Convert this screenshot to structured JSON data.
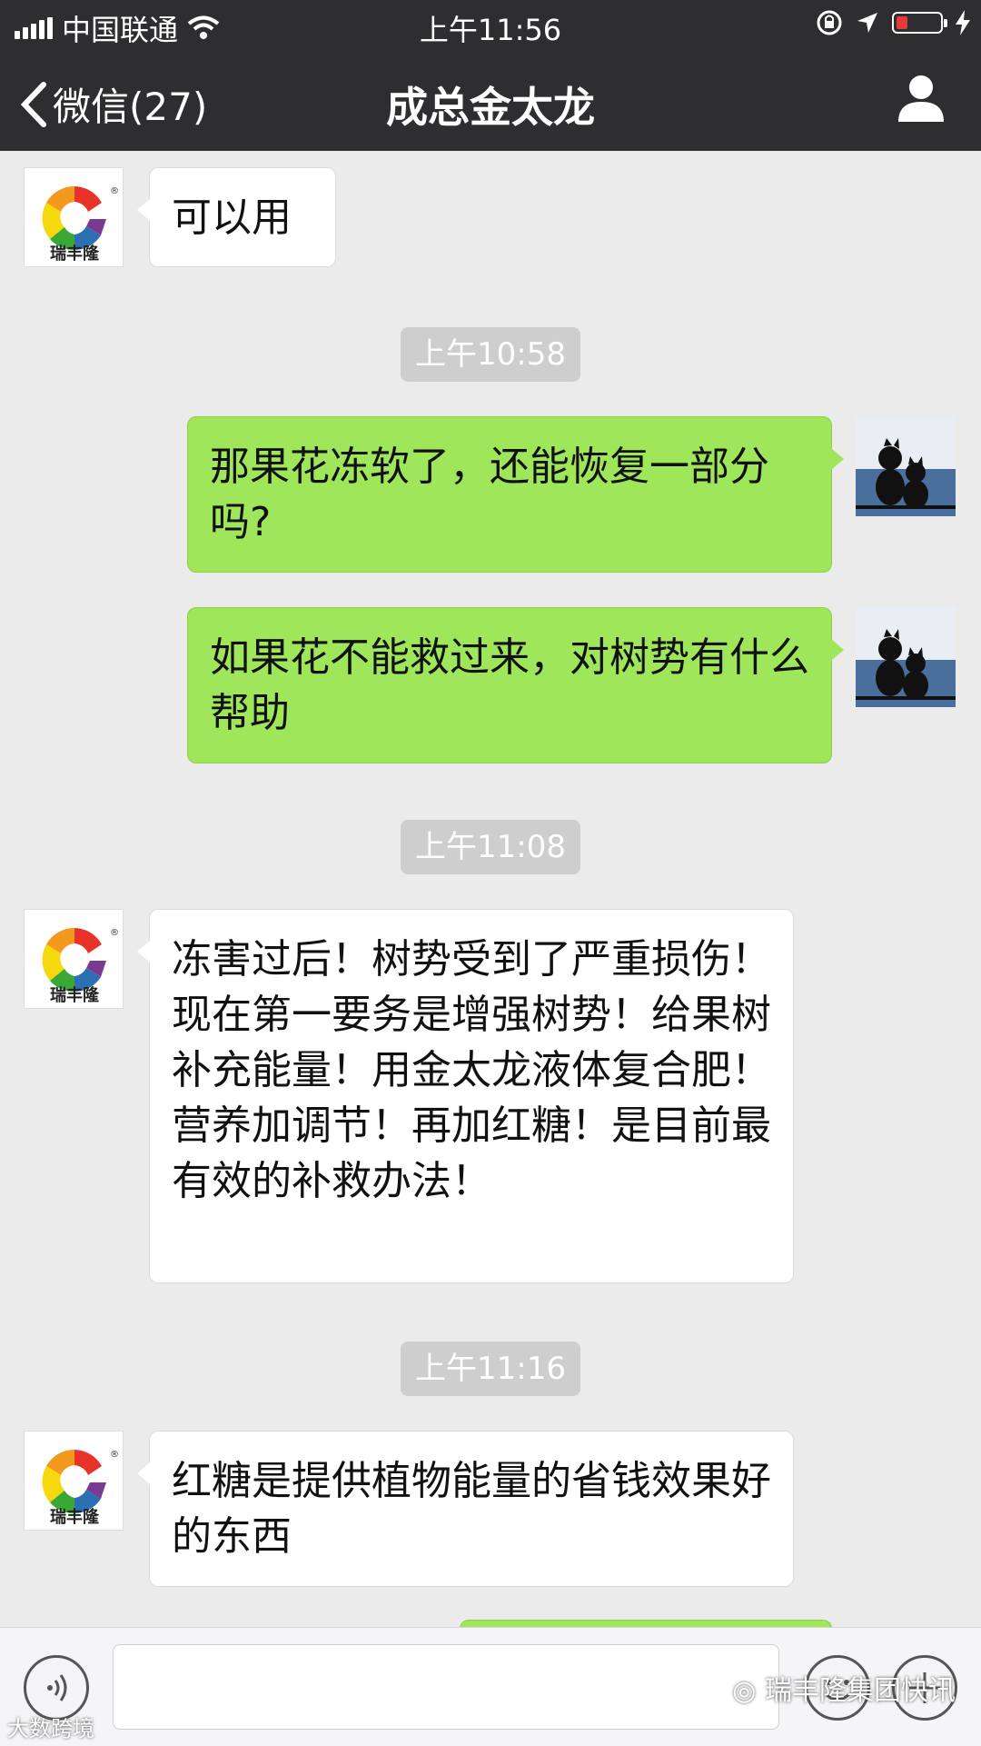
{
  "status_bar": {
    "carrier": "中国联通",
    "time": "上午11:56",
    "battery_color": "#e63a3a"
  },
  "nav": {
    "back_label": "微信(27)",
    "title": "成总金太龙",
    "icons": [
      "chevron-left-icon",
      "person-icon"
    ]
  },
  "messages": [
    {
      "side": "in",
      "text": "可以用"
    },
    {
      "type": "time",
      "text": "上午10:58"
    },
    {
      "side": "out",
      "text": "那果花冻软了，还能恢复一部分吗?"
    },
    {
      "side": "out",
      "text": "如果花不能救过来，对树势有什么帮助"
    },
    {
      "type": "time",
      "text": "上午11:08"
    },
    {
      "side": "in",
      "text": "冻害过后！树势受到了严重损伤！现在第一要务是增强树势！给果树补充能量！用金太龙液体复合肥！营养加调节！再加红糖！是目前最有效的补救办法！"
    },
    {
      "type": "time",
      "text": "上午11:16"
    },
    {
      "side": "in",
      "text": "红糖是提供植物能量的省钱效果好的东西"
    }
  ],
  "contact_avatar": {
    "brand": "瑞丰隆",
    "mark": "®"
  },
  "input_bar": {
    "icons": [
      "voice-icon",
      "emoji-icon",
      "plus-icon"
    ],
    "value": ""
  },
  "watermarks": {
    "right": "瑞丰隆集团快讯",
    "left": "大数跨境"
  },
  "colors": {
    "bar_bg": "#2e2e30",
    "chat_bg": "#ebebeb",
    "out_bubble": "#9fe65a",
    "in_bubble": "#ffffff"
  }
}
